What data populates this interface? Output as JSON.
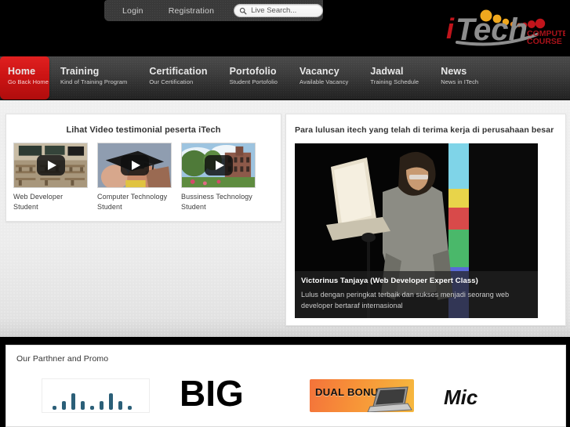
{
  "utility_bar": {
    "login_label": "Login",
    "registration_label": "Registration",
    "search_placeholder": "Live Search...",
    "search_value": "",
    "search_icon": "search-icon"
  },
  "logo": {
    "primary_text": "iTech",
    "i_text": "i",
    "tech_text": "Tech",
    "tagline_line1": "COMPUTER",
    "tagline_line2": "COURSE",
    "accent_red": "#c0141b",
    "accent_orange": "#f0a81e",
    "tech_gray": "#8d8d8d"
  },
  "nav": {
    "items": [
      {
        "title": "Home",
        "subtitle": "Go Back Home",
        "active": true
      },
      {
        "title": "Training",
        "subtitle": "Kind of Training Program",
        "active": false
      },
      {
        "title": "Certification",
        "subtitle": "Our Certification",
        "active": false
      },
      {
        "title": "Portofolio",
        "subtitle": "Student Portofolio",
        "active": false
      },
      {
        "title": "Vacancy",
        "subtitle": "Available Vacancy",
        "active": false
      },
      {
        "title": "Jadwal",
        "subtitle": "Training Schedule",
        "active": false
      },
      {
        "title": "News",
        "subtitle": "News in ITech",
        "active": false
      }
    ],
    "active_color": "#cc1414"
  },
  "video_panel": {
    "heading": "Lihat Video testimonial peserta iTech",
    "thumbnails": [
      {
        "caption": "Web Developer Student",
        "scene": "classroom-photo",
        "play_icon": "play-icon"
      },
      {
        "caption": "Computer Technology Student",
        "scene": "graduation-photo",
        "play_icon": "play-icon"
      },
      {
        "caption": "Bussiness Technology Student",
        "scene": "campus-photo",
        "play_icon": "play-icon"
      }
    ]
  },
  "testimonial_panel": {
    "heading": "Para lulusan itech yang telah di terima kerja di perusahaan besar",
    "photo": "speaker-with-laptop-photo",
    "name": "Victorinus Tanjaya (Web Developer Expert Class)",
    "description": "Lulus dengan peringkat terbaik dan sukses menjadi seorang web developer bertaraf internasional"
  },
  "partner_panel": {
    "title": "Our Parthner and Promo",
    "logos": [
      {
        "name": "cisco-logo",
        "text": ""
      },
      {
        "name": "big-logo",
        "text": "BIG"
      },
      {
        "name": "dual-bonus-promo",
        "text": "DUAL BONUS !!!"
      },
      {
        "name": "microsoft-logo",
        "text": "Mic"
      }
    ]
  }
}
